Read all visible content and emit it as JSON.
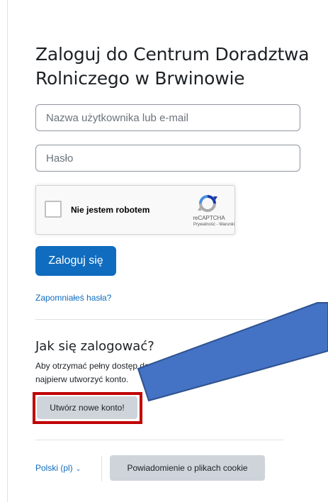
{
  "login": {
    "title": "Zaloguj do Centrum Doradztwa Rolniczego w Brwinowie",
    "username_placeholder": "Nazwa użytkownika lub e-mail",
    "password_placeholder": "Hasło",
    "submit_label": "Zaloguj się",
    "forgot_link": "Zapomniałeś hasła?"
  },
  "recaptcha": {
    "label": "Nie jestem robotem",
    "brand": "reCAPTCHA",
    "links": "Prywatność - Warunki"
  },
  "signup": {
    "title": "Jak się zalogować?",
    "text": "Aby otrzymać pełny dostęp do kursów w tym serwisie musisz najpierw utworzyć konto.",
    "button_label": "Utwórz nowe konto!"
  },
  "footer": {
    "language": "Polski (pl)",
    "cookie_button": "Powiadomienie o plikach cookie"
  },
  "colors": {
    "primary": "#0f6cbf",
    "annotation_box": "#c00000",
    "annotation_arrow": "#4472c4"
  },
  "icons": {
    "captcha_logo": "recaptcha-logo-icon",
    "language_chevron": "chevron-down-icon"
  }
}
